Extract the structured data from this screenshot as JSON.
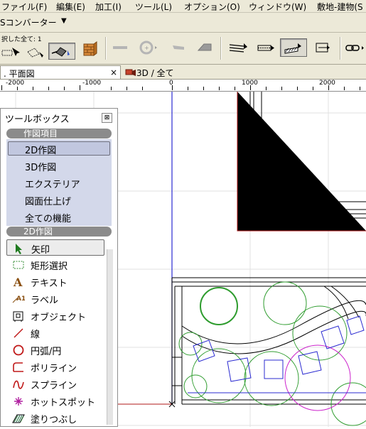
{
  "menubar": {
    "items": [
      "ファイル(F)",
      "編集(E)",
      "加工(I)",
      "ツール(L)",
      "オプション(O)",
      "ウィンドウ(W)",
      "敷地-建物(S"
    ]
  },
  "converter": {
    "label": "Sコンバーター",
    "dropdown": "▼"
  },
  "toolbar": {
    "selection_caption": "択した全て: 1"
  },
  "tabs": {
    "plan_label": ". 平面図",
    "plan_close": "×",
    "threed_label": "3D / 全て"
  },
  "ruler": {
    "labels": [
      "-2000",
      "-1000",
      "0",
      "1000",
      "2000"
    ]
  },
  "toolbox": {
    "title": "ツールボックス",
    "close_glyph": "⊠",
    "category_header": "作図項目",
    "categories": [
      "2D作図",
      "3D作図",
      "エクステリア",
      "図面仕上げ",
      "全ての機能"
    ],
    "selected_category": "2D作図",
    "section_header": "2D作図",
    "tools": [
      {
        "label": "矢印",
        "icon": "arrow-icon"
      },
      {
        "label": "矩形選択",
        "icon": "marquee-icon"
      },
      {
        "label": "テキスト",
        "icon": "text-icon"
      },
      {
        "label": "ラベル",
        "icon": "label-icon"
      },
      {
        "label": "オブジェクト",
        "icon": "object-icon"
      },
      {
        "label": "線",
        "icon": "line-icon"
      },
      {
        "label": "円弧/円",
        "icon": "circle-icon"
      },
      {
        "label": "ポリライン",
        "icon": "polyline-icon"
      },
      {
        "label": "スプライン",
        "icon": "spline-icon"
      },
      {
        "label": "ホットスポット",
        "icon": "hotspot-icon"
      },
      {
        "label": "塗りつぶし",
        "icon": "fill-icon"
      }
    ],
    "selected_tool": "矢印"
  },
  "colors": {
    "accent_blue": "#2b2bd1",
    "plant_green": "#2e9c2e",
    "magenta": "#cc22cc",
    "axis_red": "#b01a1a"
  }
}
